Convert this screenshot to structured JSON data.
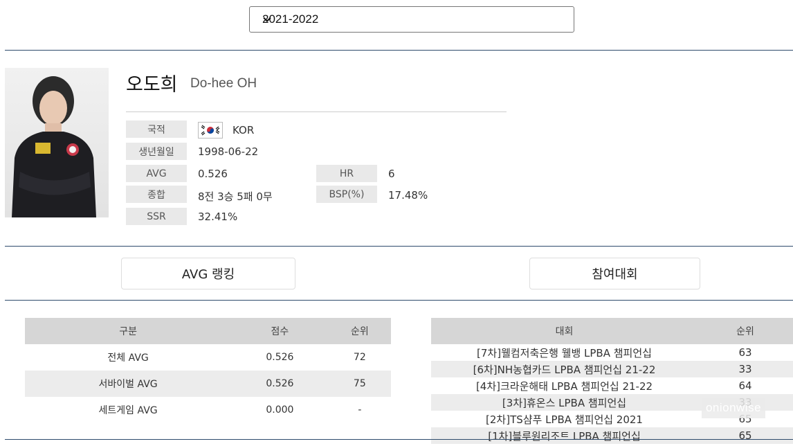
{
  "season_select": {
    "value": "2021-2022"
  },
  "player": {
    "name_ko": "오도희",
    "name_en": "Do-hee OH",
    "labels": {
      "nationality": "국적",
      "birth": "생년월일",
      "avg": "AVG",
      "hr": "HR",
      "total": "종합",
      "bsp": "BSP(%)",
      "ssr": "SSR"
    },
    "values": {
      "nationality": "KOR",
      "birth": "1998-06-22",
      "avg": "0.526",
      "hr": "6",
      "total": "8전 3승 5패 0무",
      "bsp": "17.48%",
      "ssr": "32.41%"
    }
  },
  "tabs": {
    "avg_ranking": "AVG 랭킹",
    "tournaments": "참여대회"
  },
  "avg_table": {
    "headers": [
      "구분",
      "점수",
      "순위"
    ],
    "rows": [
      [
        "전체 AVG",
        "0.526",
        "72"
      ],
      [
        "서바이벌 AVG",
        "0.526",
        "75"
      ],
      [
        "세트게임 AVG",
        "0.000",
        "-"
      ]
    ]
  },
  "comp_table": {
    "headers": [
      "대회",
      "순위"
    ],
    "rows": [
      [
        "[7차]웰컴저축은행 웰뱅 LPBA 챔피언십",
        "63"
      ],
      [
        "[6차]NH농협카드 LPBA 챔피언십 21-22",
        "33"
      ],
      [
        "[4차]크라운해태 LPBA 챔피언십 21-22",
        "64"
      ],
      [
        "[3차]휴온스 LPBA 챔피언십",
        "33"
      ],
      [
        "[2차]TS샴푸 LPBA 챔피언십 2021",
        "65"
      ],
      [
        "[1차]블루원리조트 LPBA 챔피언십",
        "65"
      ]
    ]
  },
  "watermark": "onionwise"
}
